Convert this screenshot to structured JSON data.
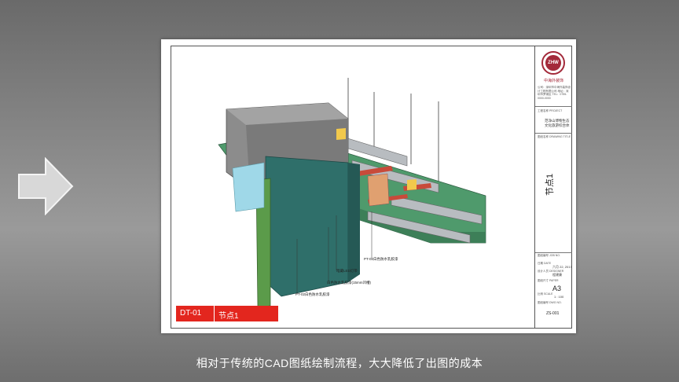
{
  "sheet": {
    "company_name": "中海外装饰",
    "logo_text": "ZHW",
    "company_info": "公司：深圳市中海外装饰设计工程有限公司 地址：深圳市罗湖区 TEL：0755-0000-0000",
    "project_label": "工程名称 PROJECT",
    "project_name": "范净山博物生态文化旅游综合体",
    "drawing_title_label": "图纸名称 DRAWING TITLE",
    "drawing_title": "节点1",
    "fields": [
      {
        "label": "图纸编号 JOB NO.",
        "value": ""
      },
      {
        "label": "日期 DATE",
        "value": "六月 22, 2017"
      },
      {
        "label": "设计人员 DESIGNER",
        "value": "程建康"
      },
      {
        "label": "图纸尺寸 PAPER",
        "value": "A3"
      },
      {
        "label": "比例 SCALE",
        "value": "1 : 100"
      },
      {
        "label": "图纸编号 DWG NO.",
        "value": "ZS-001"
      }
    ],
    "footer_code": "DT-01",
    "footer_title": "节点1"
  },
  "annotations": [
    "PT-02白色防水乳胶漆",
    "暗藏LED灯带",
    "白色防水乳胶漆(15mm凹槽)",
    "PT-02白色防水乳胶漆"
  ],
  "subtitle": "相对于传统的CAD图纸绘制流程，大大降低了出图的成本",
  "colors": {
    "accent": "#e3261e",
    "logo": "#a32a3a",
    "panel": "#3e8a6e"
  }
}
